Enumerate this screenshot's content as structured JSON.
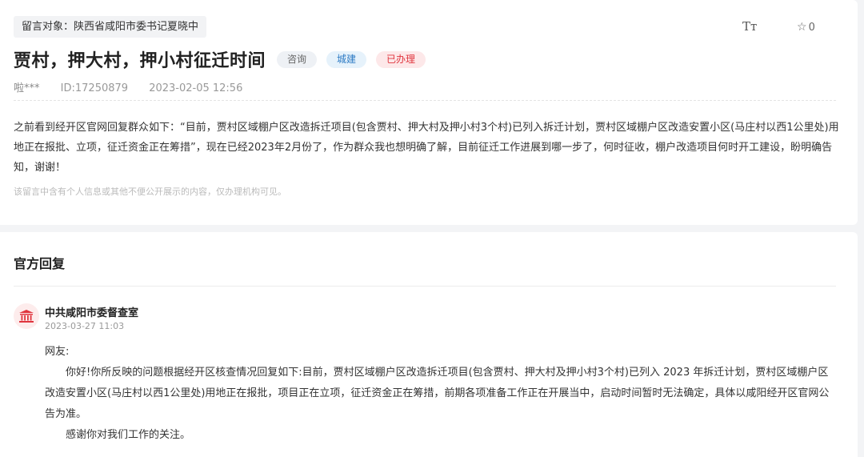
{
  "message": {
    "target": "留言对象：陕西省咸阳市委书记夏晓中",
    "title": "贾村，押大村，押小村征迁时间",
    "tags": [
      "咨询",
      "城建",
      "已办理"
    ],
    "author": "啦***",
    "id": "ID:17250879",
    "datetime": "2023-02-05 12:56",
    "content": "之前看到经开区官网回复群众如下：“目前，贾村区域棚户区改造拆迁项目(包含贾村、押大村及押小村3个村)已列入拆迁计划，贾村区域棚户区改造安置小区(马庄村以西1公里处)用地正在报批、立项，征迁资金正在筹措”，现在已经2023年2月份了，作为群众我也想明确了解，目前征迁工作进展到哪一步了，何时征收，棚户改造项目何时开工建设，盼明确告知，谢谢！",
    "privacy_note": "该留言中含有个人信息或其他不便公开展示的内容，仅办理机构可见。"
  },
  "toolbar": {
    "font_size_glyph": "Tт",
    "favorite_count": "0"
  },
  "reply": {
    "heading": "官方回复",
    "org_name": "中共咸阳市委督查室",
    "org_date": "2023-03-27 11:03",
    "greeting": "网友:",
    "body": "你好!你所反映的问题根据经开区核查情况回复如下:目前，贾村区域棚户区改造拆迁项目(包含贾村、押大村及押小村3个村)已列入 2023 年拆迁计划，贾村区域棚户区改造安置小区(马庄村以西1公里处)用地正在报批，项目正在立项，征迁资金正在筹措，前期各项准备工作正在开展当中，启动时间暂时无法确定，具体以咸阳经开区官网公告为准。",
    "closing": "感谢你对我们工作的关注。"
  },
  "colors": {
    "accent_red": "#e0353e",
    "accent_blue": "#2d7bc4",
    "org_badge_bg": "#fdecec"
  },
  "icons": [
    "font-size-icon",
    "star-icon",
    "government-building-icon"
  ]
}
